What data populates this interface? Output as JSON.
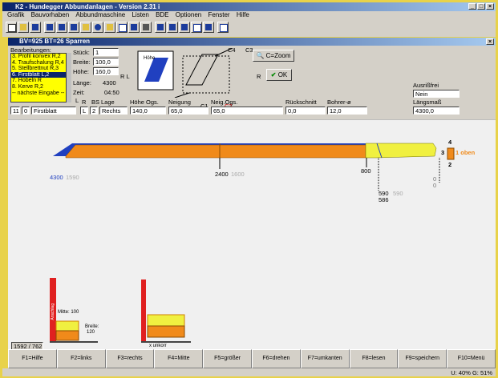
{
  "app": {
    "title": "K2 - Hundegger Abbundanlagen - Version 2.31 i",
    "menu": [
      "Grafik",
      "Bauvorhaben",
      "Abbundmaschine",
      "Listen",
      "BDE",
      "Optionen",
      "Fenster",
      "Hilfe"
    ]
  },
  "window": {
    "title": "BV=925  BT=26 Sparren"
  },
  "form": {
    "bearbeitungen_label": "Bearbeitungen:",
    "bearbeitungen": [
      "3. Profil konvex R,2",
      "4. Traufschalung R,4",
      "5. Stellbrettnut R,3",
      "6. Firstblatt L,2",
      "7. Hobeln R",
      "8. Kerve R,2",
      "-- nächste Eingabe --"
    ],
    "selected_index": 3,
    "stueck_label": "Stück:",
    "stueck_value": "1",
    "breite_label": "Breite:",
    "breite_value": "100,0",
    "hoehe_label": "Höhe:",
    "hoehe_value": "160,0",
    "laenge_label": "Länge:",
    "laenge_value": "4300",
    "zeit_label": "Zeit:",
    "zeit_value": "04:50",
    "rl": "R L",
    "huehe_mini": "Höhe",
    "side_labels": {
      "c4": "C4",
      "c3": "C3",
      "r": "R",
      "c1": "C1",
      "c2": "C2"
    },
    "zoom_label": "C=Zoom",
    "ok_label": "OK",
    "ausrissfrei_label": "Ausrißfrei",
    "ausrissfrei_value": "Nein",
    "laengsmass_label": "Längsmaß",
    "laengsmass_value": "4300,0"
  },
  "param_row": {
    "nr": "11",
    "typ": "0",
    "name": "Firstblatt",
    "L_mark": "L",
    "R_mark": "R",
    "bs_label": "BS",
    "bs_value": "L",
    "lage_label": "Lage",
    "lage_num": "2",
    "lage_value": "Rechts",
    "hoehe_ogs_label": "Höhe Ogs.",
    "hoehe_ogs_value": "140,0",
    "neigung_label": "Neigung",
    "neigung_value": "65,0",
    "neig_ogs_label": "Neig.Ogs.",
    "neig_ogs_value": "65,0",
    "rueckschnitt_label": "Rückschnitt",
    "rueckschnitt_value": "0,0",
    "bohrer_label": "Bohrer-ø",
    "bohrer_value": "12,0"
  },
  "canvas": {
    "dim_start": "4300",
    "dim_start_gray": "1590",
    "dim_mid": "2400",
    "dim_mid_gray": "1600",
    "dim_800": "800",
    "dim_590": "590",
    "dim_590_gray": "590",
    "dim_586": "586",
    "zero1": "0",
    "zero2": "0",
    "side_top": "4",
    "side_left": "3",
    "side_right": "1 oben",
    "side_bottom": "2",
    "anschlag_label": "Anschlag",
    "mitte_label": "Mitte: 100",
    "breite_label": "Breite:",
    "breite_value": "120",
    "x_label": "x unkorr",
    "coord": "1592 / 762",
    "colors": {
      "beam": "#f08a1a",
      "end": "#f0f040",
      "blue": "#2040c0"
    }
  },
  "fkeys": [
    "F1=Hilfe",
    "F2=links",
    "F3=rechts",
    "F4=Mitte",
    "F5=größer",
    "F6=drehen",
    "F7=umkanten",
    "F8=lesen",
    "F9=speichern",
    "F10=Menü"
  ],
  "status": "U: 40%  G: 51%"
}
